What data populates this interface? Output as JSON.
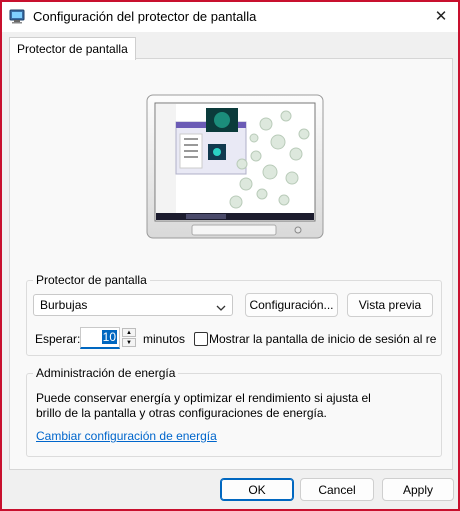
{
  "window": {
    "title": "Configuración del protector de pantalla",
    "app_icon": "monitor-settings-icon",
    "close_icon": "close-icon"
  },
  "tabs": [
    {
      "label": "Protector de pantalla",
      "active": true
    }
  ],
  "screensaver": {
    "group_label": "Protector de pantalla",
    "selected": "Burbujas",
    "settings_button": "Configuración...",
    "preview_button": "Vista previa",
    "wait_label": "Esperar:",
    "wait_value": "10",
    "minutes_label": "minutos",
    "resume_checkbox_label": "Mostrar la pantalla de inicio de sesión al re",
    "resume_checked": false
  },
  "power": {
    "group_label": "Administración de energía",
    "description_line1": "Puede conservar energía y optimizar el rendimiento si ajusta el",
    "description_line2": "brillo de la pantalla y otras configuraciones de energía.",
    "link": "Cambiar configuración de energía"
  },
  "footer": {
    "ok": "OK",
    "cancel": "Cancel",
    "apply": "Apply"
  },
  "colors": {
    "accent": "#0067c0",
    "window_border": "#c8102e",
    "link": "#0066cc"
  }
}
